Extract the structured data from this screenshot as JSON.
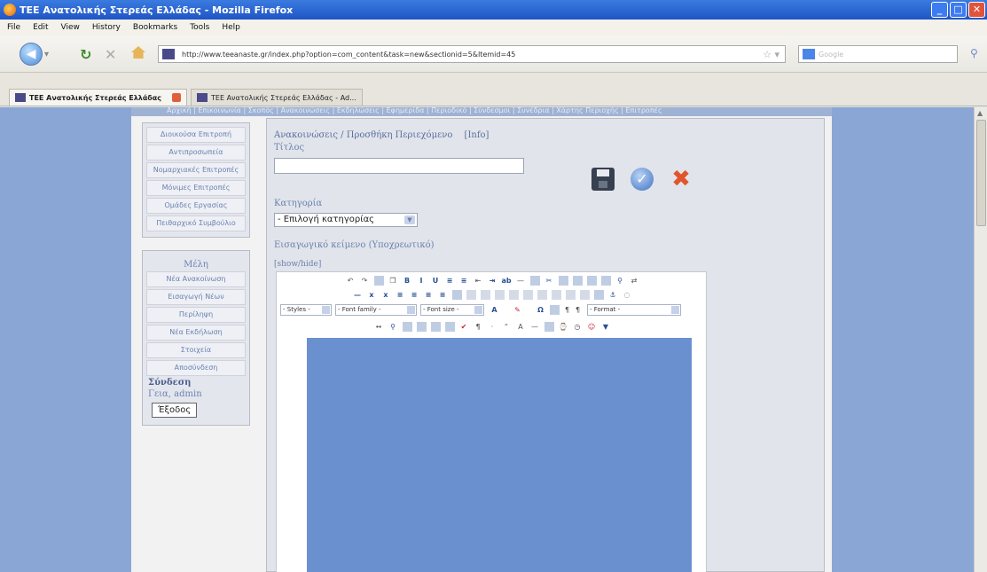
{
  "window": {
    "title": "TEE Ανατολικής Στερεάς Ελλάδας - Mozilla Firefox",
    "controls": [
      "_",
      "□",
      "✕"
    ]
  },
  "menubar": [
    "File",
    "Edit",
    "View",
    "History",
    "Bookmarks",
    "Tools",
    "Help"
  ],
  "nav": {
    "url": "http://www.teeanaste.gr/index.php?option=com_content&task=new&sectionid=5&Itemid=45",
    "search_placeholder": "Google"
  },
  "tabs": [
    {
      "label": "TEE Ανατολικής Στερεάς Ελλάδας"
    },
    {
      "label": "TEE Ανατολικής Στερεάς Ελλάδας - Ad..."
    }
  ],
  "page": {
    "topnav": "Αρχική | Επικοινωνία | Σκοπός | Ανακοινώσεις | Εκδηλώσεις | Εφημερίδα | Περιοδικό | Σύνδεσμοι | Συνέδρια | Χάρτης Περιοχής | Επιτροπές",
    "sidebar_menu": [
      "Διοικούσα Επιτροπή",
      "Αντιπροσωπεία",
      "Νομαρχιακές Επιτροπές",
      "Μόνιμες Επιτροπές",
      "Ομάδες Εργασίας",
      "Πειθαρχικό Συμβούλιο"
    ],
    "members": {
      "title": "Μέλη",
      "items": [
        "Νέα Ανακοίνωση",
        "Εισαγωγή Νέων",
        "Περίληψη",
        "Νέα Εκδήλωση",
        "Στοιχεία",
        "Αποσύνδεση"
      ],
      "login_label": "Σύνδεση",
      "greeting": "Γεια, admin",
      "logout": "Έξοδος"
    },
    "form": {
      "heading": "Ανακοινώσεις / Προσθήκη Περιεχόμενο",
      "info": "[Info]",
      "title_label": "Τίτλος",
      "title_value": "",
      "category_label": "Κατηγορία",
      "category_value": "- Επιλογή κατηγορίας",
      "intro_label": "Εισαγωγικό κείμενο (Υποχρεωτικό)",
      "showhide": "[show/hide]"
    },
    "editor": {
      "styles": "- Styles -",
      "font_family": "- Font family -",
      "font_size": "- Font size -",
      "format": "- Format -"
    }
  }
}
